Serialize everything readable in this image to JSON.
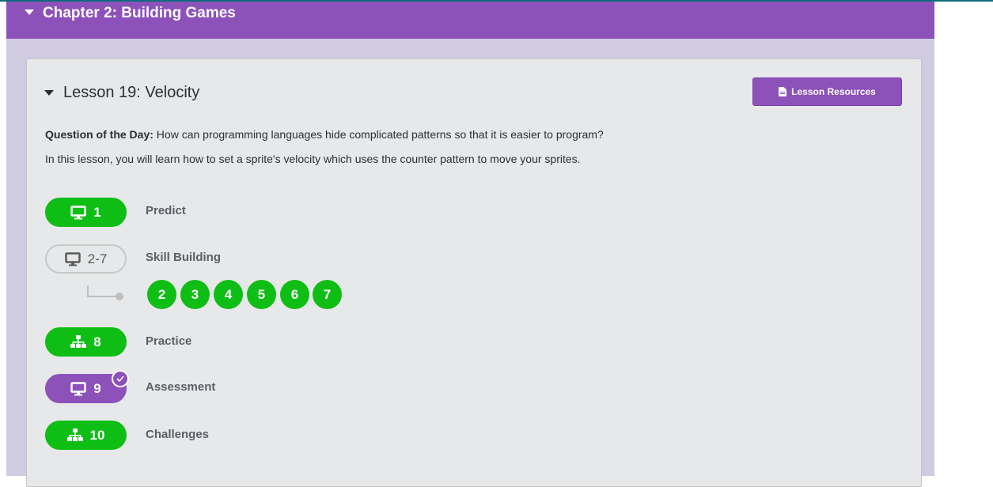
{
  "chapter": {
    "title": "Chapter 2: Building Games"
  },
  "lesson": {
    "title": "Lesson 19: Velocity",
    "resources_label": "Lesson Resources",
    "qotd_label": "Question of the Day:",
    "qotd_text": " How can programming languages hide complicated patterns so that it is easier to program?",
    "intro": "In this lesson, you will learn how to set a sprite's velocity which uses the counter pattern to move your sprites."
  },
  "levels": [
    {
      "number": "1",
      "label": "Predict",
      "icon": "desktop-icon",
      "status": "completed"
    },
    {
      "number": "2-7",
      "label": "Skill Building",
      "icon": "desktop-icon",
      "status": "not-started"
    },
    {
      "number": "8",
      "label": "Practice",
      "icon": "sitemap-icon",
      "status": "completed"
    },
    {
      "number": "9",
      "label": "Assessment",
      "icon": "desktop-icon",
      "status": "submitted"
    },
    {
      "number": "10",
      "label": "Challenges",
      "icon": "sitemap-icon",
      "status": "completed"
    }
  ],
  "sublevels": [
    "2",
    "3",
    "4",
    "5",
    "6",
    "7"
  ],
  "colors": {
    "chapter_bar": "#8c52ba",
    "completed": "#0fbe14",
    "submitted": "#8c52ba",
    "card_bg": "#e7e8ea",
    "outer_bg": "#d0cbe0"
  }
}
